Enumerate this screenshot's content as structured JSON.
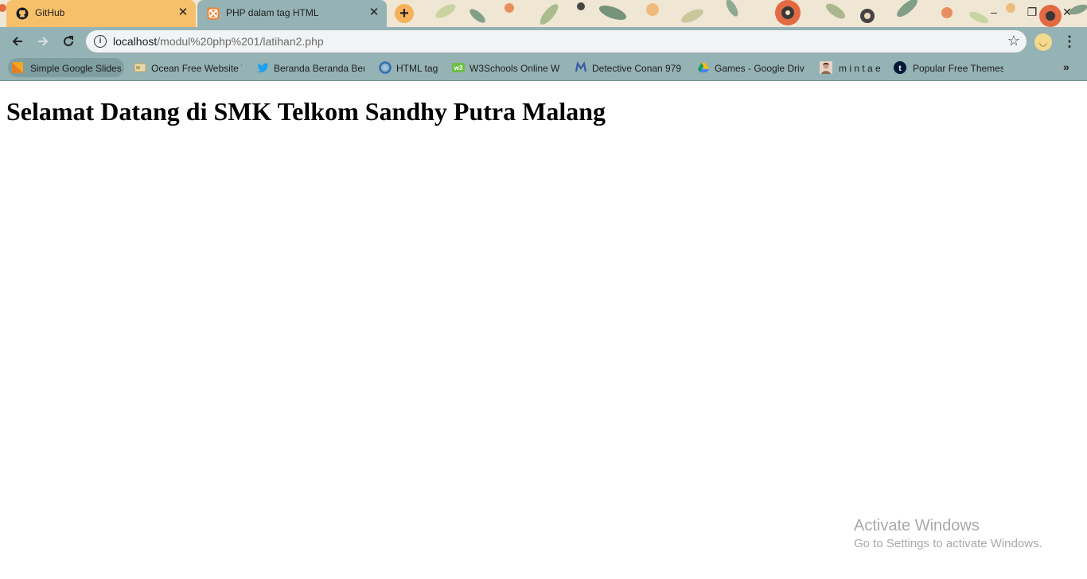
{
  "tabs": [
    {
      "title": "GitHub",
      "icon": "github-icon",
      "active": false
    },
    {
      "title": "PHP dalam tag HTML",
      "icon": "xampp-icon",
      "active": true
    }
  ],
  "tab_close_glyph": "✕",
  "new_tab_glyph": "+",
  "window_controls": {
    "minimize": "–",
    "maximize": "❐",
    "close": "✕"
  },
  "toolbar": {
    "url_host": "localhost",
    "url_path": "/modul%20php%201/latihan2.php"
  },
  "bookmarks": [
    {
      "label": "Simple Google Slides",
      "icon": "slides-icon"
    },
    {
      "label": "Ocean Free Website T",
      "icon": "template-icon"
    },
    {
      "label": "Beranda Beranda Ber",
      "icon": "twitter-icon"
    },
    {
      "label": "HTML tag",
      "icon": "html-tag-icon"
    },
    {
      "label": "W3Schools Online W",
      "icon": "w3schools-icon"
    },
    {
      "label": "Detective Conan 979",
      "icon": "manga-icon"
    },
    {
      "label": "Games - Google Driv",
      "icon": "drive-icon"
    },
    {
      "label": "m i n t a e",
      "icon": "avatar-icon"
    },
    {
      "label": "Popular Free Themes",
      "icon": "tumblr-icon"
    }
  ],
  "page": {
    "heading": "Selamat Datang di SMK Telkom Sandhy Putra Malang"
  },
  "watermark": {
    "title": "Activate Windows",
    "subtitle": "Go to Settings to activate Windows."
  },
  "colors": {
    "theme_toolbar": "#95b2b4",
    "active_tab": "#95b2b4",
    "inactive_tab": "#f6c06b",
    "new_tab_button": "#f6b25a"
  }
}
